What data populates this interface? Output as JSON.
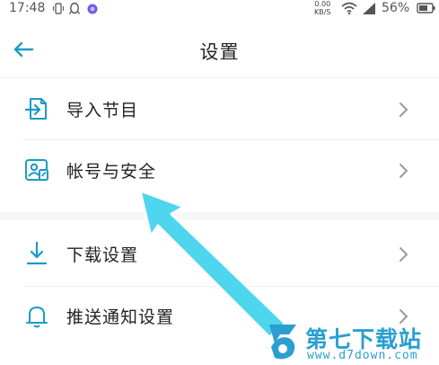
{
  "status_bar": {
    "time": "17:48",
    "net_speed_value": "0.00",
    "net_speed_unit": "KB/S",
    "battery": "56%"
  },
  "header": {
    "title": "设置"
  },
  "menu": {
    "items": [
      {
        "label": "导入节目"
      },
      {
        "label": "帐号与安全"
      },
      {
        "label": "下载设置"
      },
      {
        "label": "推送通知设置"
      }
    ]
  },
  "watermark": {
    "name": "第七下载站",
    "url": "www.d7down.com"
  },
  "colors": {
    "accent": "#1a9bc6",
    "arrow": "#4fd6ef",
    "watermark": "#2a9fd0"
  }
}
